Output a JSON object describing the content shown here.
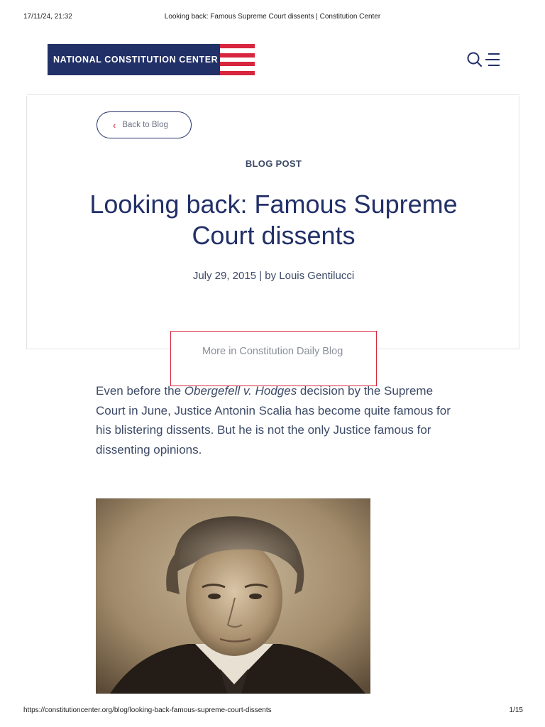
{
  "print_header": {
    "datetime": "17/11/24, 21:32",
    "page_title": "Looking back: Famous Supreme Court dissents | Constitution Center"
  },
  "header": {
    "logo_text": "NATIONAL CONSTITUTION CENTER",
    "icons": [
      "search-icon",
      "menu-icon"
    ]
  },
  "hero": {
    "back_label": "Back to Blog",
    "eyebrow": "BLOG POST",
    "title": "Looking back: Famous Supreme Court dissents",
    "byline": "July 29, 2015 | by Louis Gentilucci"
  },
  "more_box": {
    "label": "More in Constitution Daily Blog"
  },
  "article": {
    "p1_before": "Even before the ",
    "p1_case": "Obergefell v. Hodges",
    "p1_after": " decision by the Supreme Court in June, Justice Antonin Scalia has become quite famous for his blistering dissents. But he is not the only Justice famous for dissenting opinions."
  },
  "colors": {
    "navy": "#223068",
    "red": "#d7263d",
    "text": "#3c4a66"
  },
  "print_footer": {
    "url": "https://constitutioncenter.org/blog/looking-back-famous-supreme-court-dissents",
    "page": "1/15"
  }
}
